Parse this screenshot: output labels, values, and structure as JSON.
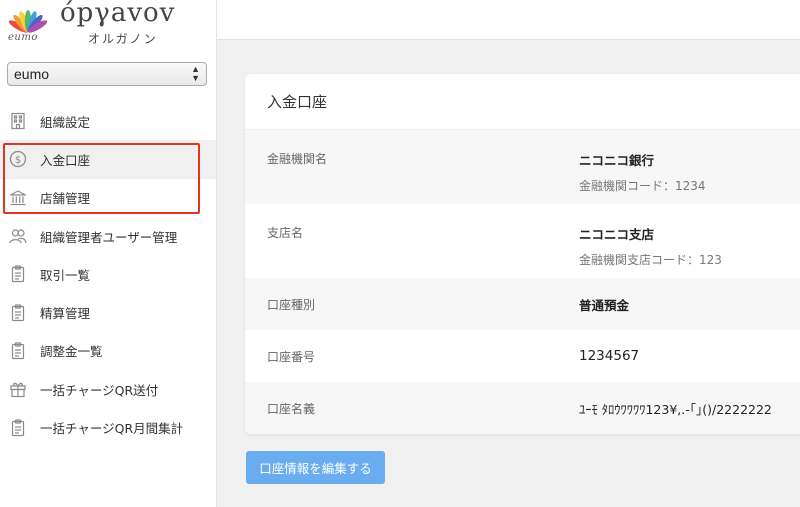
{
  "brand": {
    "logo_text": "eumo",
    "wordmark": "όpγavov",
    "kana": "オルガノン",
    "colors": [
      "#e94e3c",
      "#f39c33",
      "#f6d046",
      "#59b85c",
      "#3aa4d8",
      "#5a5fc4",
      "#b04fb3"
    ]
  },
  "org_select": {
    "value": "eumo",
    "arrows": "▲▼"
  },
  "nav": {
    "items": [
      {
        "label": "組織設定",
        "icon": "building-icon"
      },
      {
        "label": "入金口座",
        "icon": "dollar-circle-icon"
      },
      {
        "label": "店舗管理",
        "icon": "bank-icon"
      },
      {
        "label": "組織管理者ユーザー管理",
        "icon": "users-icon"
      },
      {
        "label": "取引一覧",
        "icon": "clipboard-icon"
      },
      {
        "label": "精算管理",
        "icon": "clipboard-icon"
      },
      {
        "label": "調整金一覧",
        "icon": "clipboard-icon"
      },
      {
        "label": "一括チャージQR送付",
        "icon": "gift-icon"
      },
      {
        "label": "一括チャージQR月間集計",
        "icon": "clipboard-icon"
      }
    ],
    "active_index": 1
  },
  "card": {
    "title": "入金口座",
    "rows": [
      {
        "label": "金融機関名",
        "value": "ニコニコ銀行",
        "sub": "金融機関コード：1234"
      },
      {
        "label": "支店名",
        "value": "ニコニコ支店",
        "sub": "金融機関支店コード：123"
      },
      {
        "label": "口座種別",
        "value": "普通預金"
      },
      {
        "label": "口座番号",
        "value": "1234567"
      },
      {
        "label": "口座名義",
        "value": "ﾕｰﾓ ﾀﾛｳﾜﾜﾜﾜ123¥,.-｢｣()/2222222"
      }
    ]
  },
  "edit_button": {
    "label": "口座情報を編集する"
  }
}
